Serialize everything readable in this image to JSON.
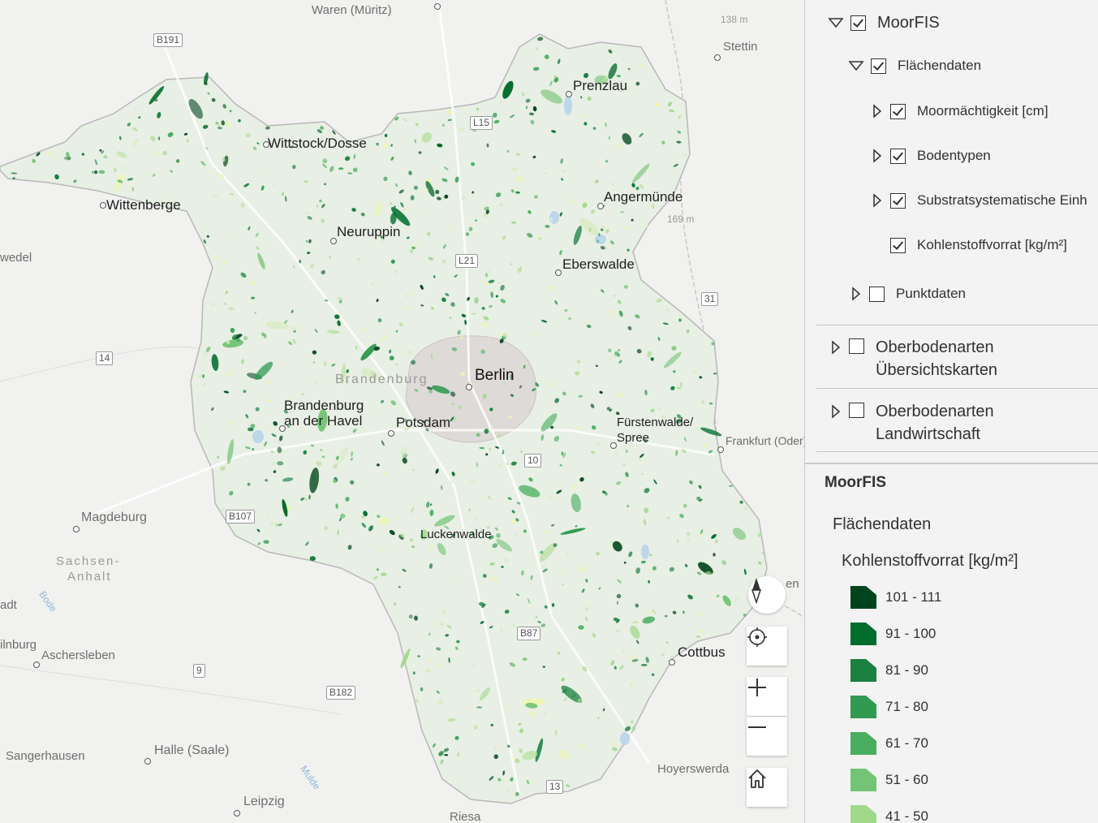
{
  "map": {
    "places": [
      {
        "name": "Waren (Müritz)",
        "cls": "town"
      },
      {
        "name": "Stettin",
        "cls": "town"
      },
      {
        "name": "Prenzlau",
        "cls": "city"
      },
      {
        "name": "Wittstock/Dosse",
        "cls": "city"
      },
      {
        "name": "Wittenberge",
        "cls": "city"
      },
      {
        "name": "Neuruppin",
        "cls": "city"
      },
      {
        "name": "Angermünde",
        "cls": "city"
      },
      {
        "name": "Eberswalde",
        "cls": "city"
      },
      {
        "name": "Berlin",
        "cls": "city-big"
      },
      {
        "name": "Potsdam",
        "cls": "city"
      },
      {
        "name": "Brandenburg an der Havel",
        "cls": "city"
      },
      {
        "name": "Fürstenwalde/ Spree",
        "cls": "city"
      },
      {
        "name": "Frankfurt (Oder)",
        "cls": "town"
      },
      {
        "name": "Magdeburg",
        "cls": "town"
      },
      {
        "name": "Luckenwalde",
        "cls": "city"
      },
      {
        "name": "Cottbus",
        "cls": "city"
      },
      {
        "name": "Aschersleben",
        "cls": "town"
      },
      {
        "name": "Halle (Saale)",
        "cls": "town"
      },
      {
        "name": "Hoyerswerda",
        "cls": "town"
      },
      {
        "name": "Sangerhausen",
        "cls": "town"
      },
      {
        "name": "Leipzig",
        "cls": "town"
      },
      {
        "name": "Riesa",
        "cls": "town"
      },
      {
        "name": "wedel",
        "cls": "town"
      },
      {
        "name": "adt",
        "cls": "town"
      },
      {
        "name": "ilnburg",
        "cls": "town"
      },
      {
        "name": "en",
        "cls": "town"
      }
    ],
    "regions": [
      "Brandenburg",
      "Sachsen-",
      "Anhalt"
    ],
    "peaks": [
      "138 m",
      "169 m"
    ],
    "rivers": [
      "Bode",
      "Mulde"
    ],
    "roads": [
      "B191",
      "L15",
      "L21",
      "31",
      "14",
      "10",
      "B107",
      "B87",
      "9",
      "B182",
      "13"
    ],
    "controls": {
      "compass": "compass-icon",
      "locate": "locate-icon",
      "zoom_in": "plus-icon",
      "zoom_out": "minus-icon",
      "home": "home-icon"
    }
  },
  "layers": {
    "root": {
      "label": "MoorFIS",
      "checked": true,
      "expanded": true
    },
    "flaechendaten": {
      "label": "Flächendaten",
      "checked": true,
      "expanded": true
    },
    "children": [
      {
        "label": "Moormächtigkeit [cm]",
        "checked": true,
        "expandable": true
      },
      {
        "label": "Bodentypen",
        "checked": true,
        "expandable": true
      },
      {
        "label": "Substratsystematische Einh",
        "checked": true,
        "expandable": true
      },
      {
        "label": "Kohlenstoffvorrat [kg/m²]",
        "checked": true,
        "expandable": false
      }
    ],
    "punktdaten": {
      "label": "Punktdaten",
      "checked": false
    },
    "others": [
      {
        "line1": "Oberbodenarten",
        "line2": "Übersichtskarten",
        "checked": false
      },
      {
        "line1": "Oberbodenarten",
        "line2": "Landwirtschaft",
        "checked": false
      }
    ]
  },
  "legend": {
    "title": "MoorFIS",
    "subtitle": "Flächendaten",
    "field": "Kohlenstoffvorrat [kg/m²]",
    "classes": [
      {
        "label": "101 - 111",
        "color": "#00441b"
      },
      {
        "label": "91 - 100",
        "color": "#006d2c"
      },
      {
        "label": "81 - 90",
        "color": "#1a8040"
      },
      {
        "label": "71 - 80",
        "color": "#2f9a50"
      },
      {
        "label": "61 - 70",
        "color": "#49ae60"
      },
      {
        "label": "51 - 60",
        "color": "#74c476"
      },
      {
        "label": "41 - 50",
        "color": "#a1d98b"
      }
    ]
  }
}
